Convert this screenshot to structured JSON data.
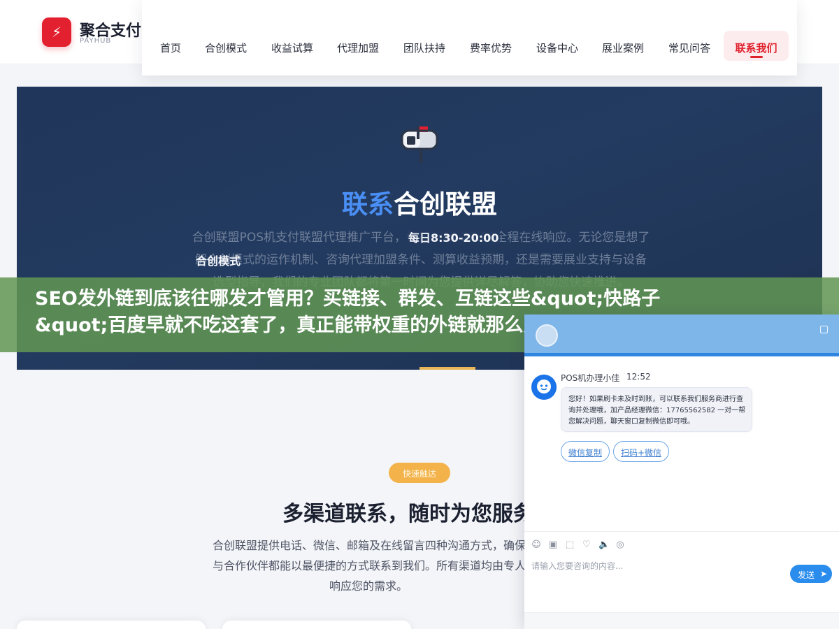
{
  "header": {
    "brand_name": "聚合支付",
    "brand_sub": "PAYHUB",
    "nav": [
      "首页",
      "合创模式",
      "收益试算",
      "代理加盟",
      "团队扶持",
      "费率优势",
      "设备中心",
      "展业案例",
      "常见问答"
    ],
    "nav_active": "联系我们"
  },
  "hero": {
    "title_blue": "联系",
    "title_white": "合创联盟",
    "desc_line1": "合创联盟POS机支付联盟代理推广平台，每日8:30-20:00全程在线响应。无论您是想了",
    "desc_line2": "解合创模式的运作机制、咨询代理加盟条件、测算收益预期，还是需要展业支持与设备",
    "desc_line3": "选型指导，我们的专业团队都将第一时间为您提供详尽解答，协助您快速推进。",
    "hours": "每日8:30-20:00",
    "tip": "合创模式"
  },
  "overlay": {
    "line1": "SEO发外链到底该往哪发才管用？买链接、群发、互链这些&quot;快路子",
    "line2": "&quot;百度早就不吃这套了，真正能带权重的外链就那么几类，发错地方"
  },
  "section": {
    "badge": "快速触达",
    "title": "多渠道联系，随时为您服务",
    "desc_line1": "合创联盟提供电话、微信、邮箱及在线留言四种沟通方式，确保每一位有意向的代理",
    "desc_line2": "与合作伙伴都能以最便捷的方式联系到我们。所有渠道均由专人负责，第一时间",
    "desc_line3": "响应您的需求。"
  },
  "chat": {
    "agent_name": "POS机办理小佳",
    "time": "12:52",
    "message_line1": "您好！如果刷卡未及时到账，可以联系我们服务商进行查",
    "message_line2": "询并处理哦，加产品经理微信：17765562582 一对一帮",
    "message_line3": "您解决问题，聊天窗口复制微信即可哦。",
    "btn_copy": "微信复制",
    "btn_scan": "扫码+微信",
    "input_placeholder": "请输入您要咨询的内容...",
    "send_label": "发送",
    "tool_icons": [
      "smile-icon",
      "image-icon",
      "crop-icon",
      "heart-icon",
      "volume-icon",
      "chat-bubbles-icon"
    ]
  },
  "colors": {
    "brand_red": "#e3202f",
    "hero_blue": "#4a8ff5",
    "overlay_green": "#6b9a58",
    "badge_orange": "#f3b34a",
    "chat_blue": "#2a8cec"
  }
}
